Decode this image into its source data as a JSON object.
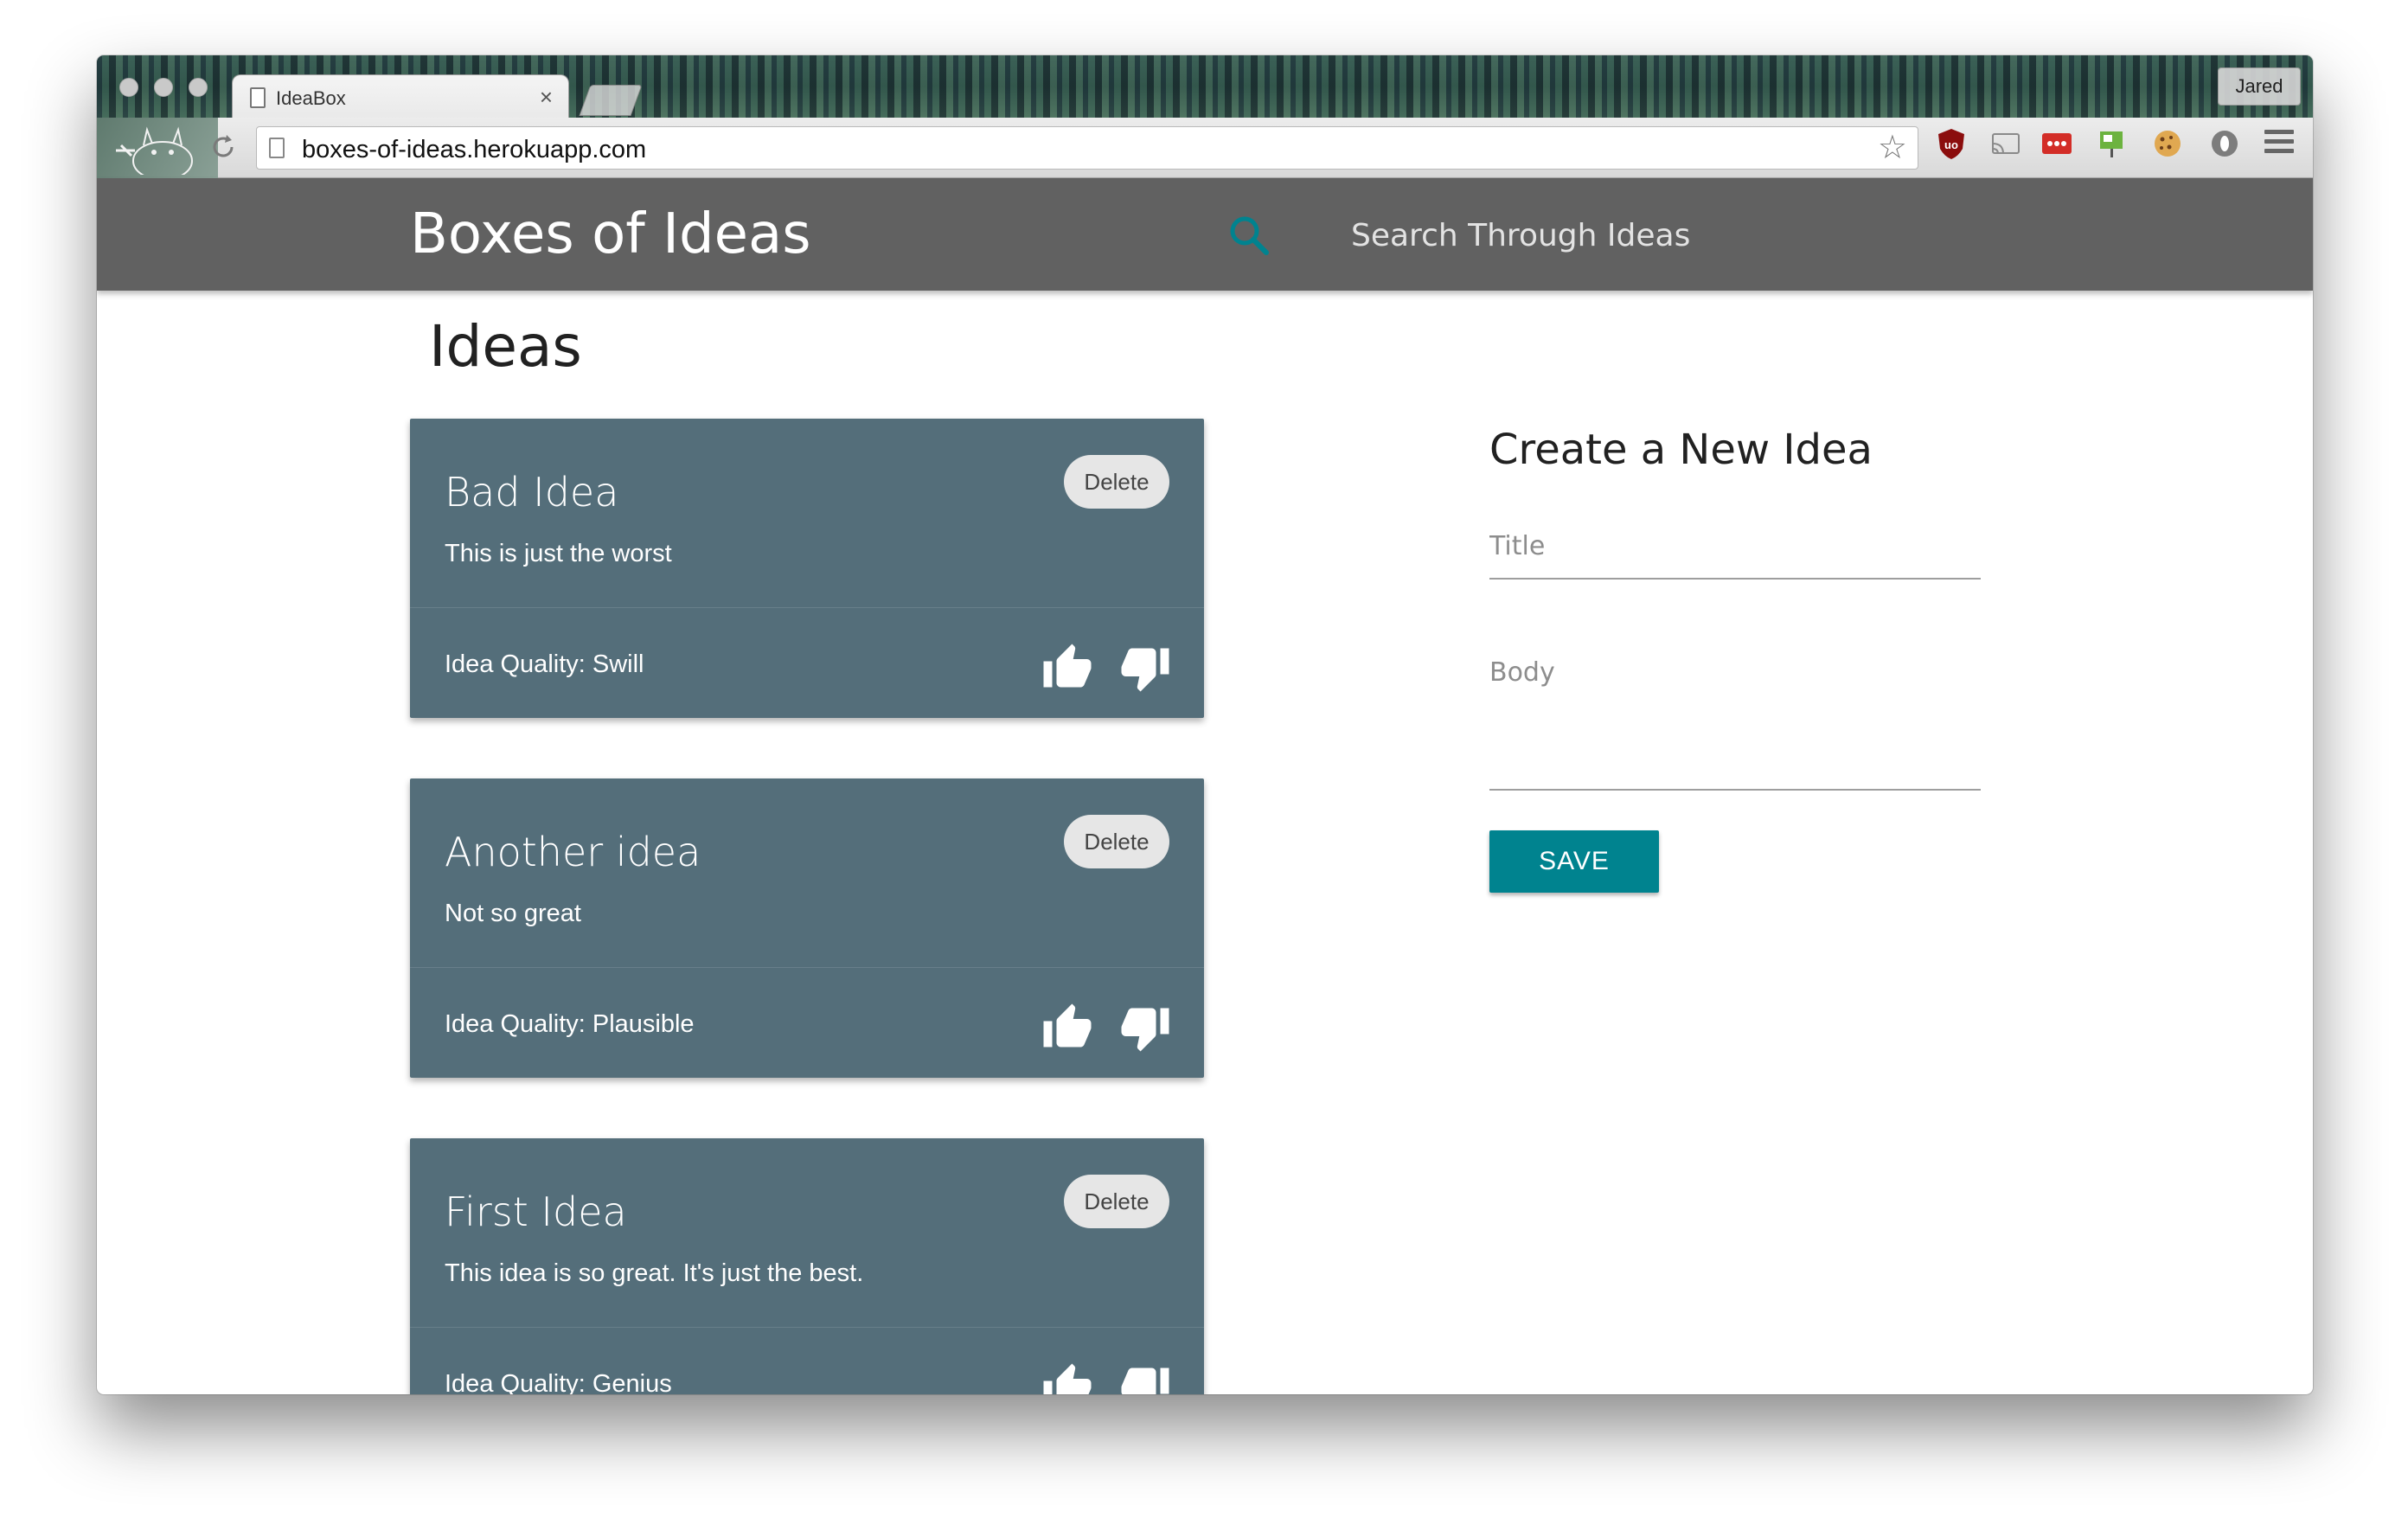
{
  "browser": {
    "tab_title": "IdeaBox",
    "tab_close": "×",
    "profile_name": "Jared",
    "url": "boxes-of-ideas.herokuapp.com"
  },
  "header": {
    "brand": "Boxes of Ideas",
    "search_placeholder": "Search Through Ideas",
    "accent_color": "#00838f"
  },
  "ideas": {
    "heading": "Ideas",
    "cards": [
      {
        "title": "Bad Idea",
        "body": "This is just the worst",
        "quality": "Idea Quality: Swill",
        "delete_label": "Delete"
      },
      {
        "title": "Another idea",
        "body": "Not so great",
        "quality": "Idea Quality: Plausible",
        "delete_label": "Delete"
      },
      {
        "title": "First Idea",
        "body": "This idea is so great. It's just the best.",
        "quality": "Idea Quality: Genius",
        "delete_label": "Delete"
      }
    ]
  },
  "form": {
    "title": "Create a New Idea",
    "title_placeholder": "Title",
    "body_placeholder": "Body",
    "save_label": "SAVE"
  },
  "colors": {
    "header_bg": "#616161",
    "card_bg": "#546e7a",
    "save_bg": "#00838f"
  },
  "icons": [
    "search-icon",
    "thumbs-up-icon",
    "thumbs-down-icon",
    "star-icon",
    "reload-icon",
    "menu-icon"
  ]
}
